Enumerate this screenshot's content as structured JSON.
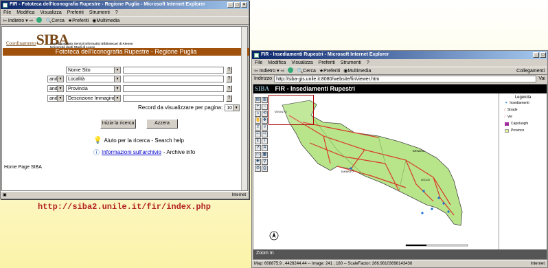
{
  "left_window": {
    "title": "FIR - Fototeca dell'Iconografia Rupestre - Regione Puglia - Microsoft Internet Explorer",
    "menu": [
      "File",
      "Modifica",
      "Visualizza",
      "Preferiti",
      "Strumenti",
      "?"
    ],
    "toolbar": {
      "back": "Indietro",
      "search": "Cerca",
      "favorites": "Preferiti",
      "media": "Multimedia"
    },
    "logo": {
      "prefix": "Coordinamento",
      "name": "SIBA",
      "line1": "Coordinamento Servizi Informatici Bibliotecari di Ateneo",
      "line2": "Università degli Studi di Lecce"
    },
    "page_title": "Fototeca dell'Iconografia Rupestre - Regione Puglia",
    "form": {
      "rows": [
        {
          "operator": "",
          "field": "Nome Sito"
        },
        {
          "operator": "and",
          "field": "Località"
        },
        {
          "operator": "and",
          "field": "Provincia"
        },
        {
          "operator": "and",
          "field": "Descrizione Immagine"
        }
      ],
      "help_symbol": "?",
      "records_label": "Record da visualizzare per pagina:",
      "records_value": "10",
      "search_button": "Inizia la ricerca",
      "reset_button": "Azzera"
    },
    "help_text": "Aiuto per la ricerca - Search help",
    "archive_link": "Informazioni sull'archivio",
    "archive_suffix": " - Archive info",
    "home_link": "Home Page SIBA",
    "status_zone": "Internet"
  },
  "caption": "http://siba2.unile.it/fir/index.php",
  "right_window": {
    "title": "FIR - Insediamenti Rupestri - Microsoft Internet Explorer",
    "menu": [
      "File",
      "Modifica",
      "Visualizza",
      "Preferiti",
      "Strumenti",
      "?"
    ],
    "toolbar": {
      "back": "Indietro",
      "search": "Cerca",
      "favorites": "Preferiti",
      "media": "Multimedia",
      "links": "Collegamenti"
    },
    "address_label": "Indirizzo",
    "address": "http://siba-gis.unile.it:8080/website/fir/viewer.htm",
    "go": "Vai",
    "map_logo": "SIBA",
    "map_title": "FIR - Insediamenti Rupestri",
    "map_labels": [
      "TARANTO",
      "BRINDISI",
      "LECCE",
      "TARANTO"
    ],
    "legend": {
      "title": "Legenda",
      "items": [
        "Insediamenti",
        "Strade",
        "Vie",
        "Capoluoghi",
        "Province"
      ]
    },
    "zoom_label": "Zoom In",
    "status": "Map: 608875.9 , 4428244.44 -- Image: 241 , 180 -- ScaleFactor: 266.98103698143436",
    "status_zone": "Internet"
  }
}
